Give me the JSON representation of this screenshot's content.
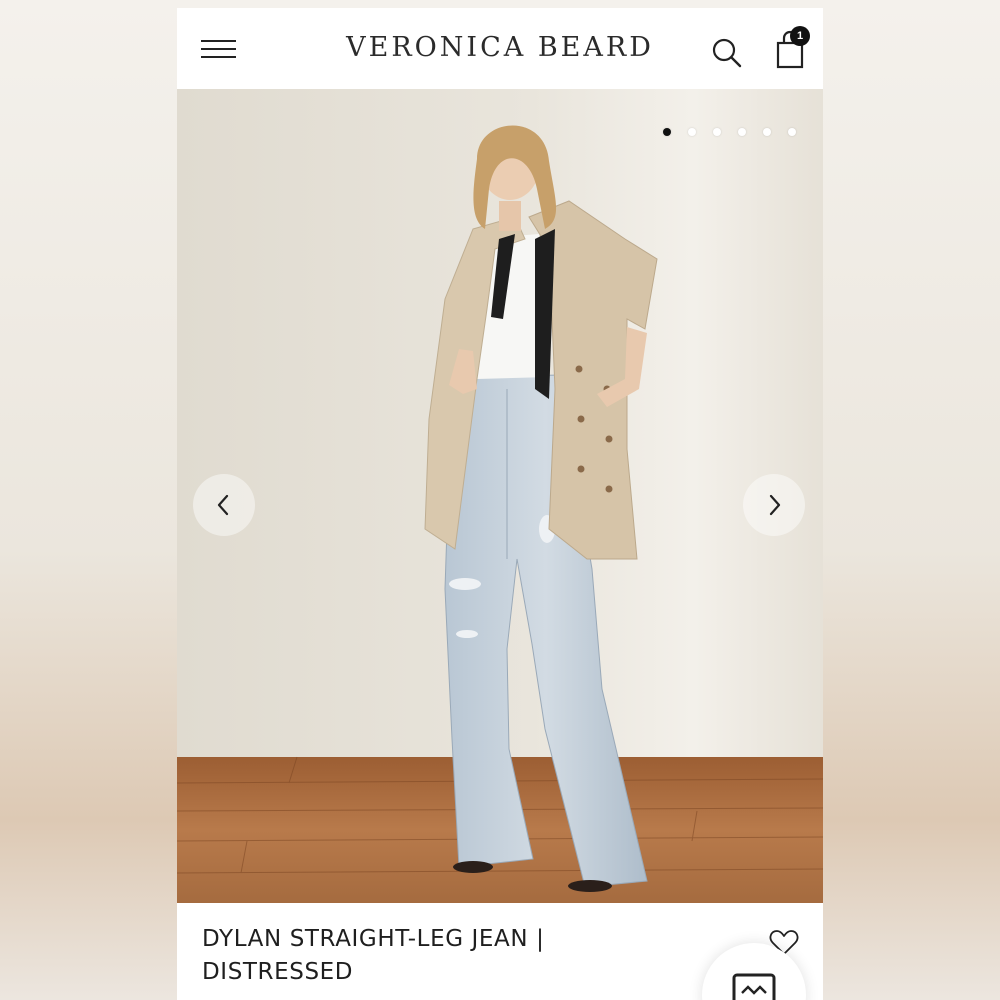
{
  "header": {
    "brand": "VERONICA BEARD",
    "menu_icon": "hamburger-menu-icon",
    "search_icon": "search-icon",
    "bag_icon": "shopping-bag-icon",
    "bag_count": "1"
  },
  "gallery": {
    "slide_count": 6,
    "active_slide": 1,
    "prev_icon": "chevron-left-icon",
    "next_icon": "chevron-right-icon"
  },
  "product": {
    "title_line1": "DYLAN STRAIGHT-LEG JEAN |",
    "title_line2": "DISTRESSED",
    "wishlist_icon": "heart-outline-icon",
    "chat_icon": "chat-icon"
  },
  "colors": {
    "accent": "#111111",
    "wall": "#e7e2d8",
    "floor": "#a6673a"
  }
}
